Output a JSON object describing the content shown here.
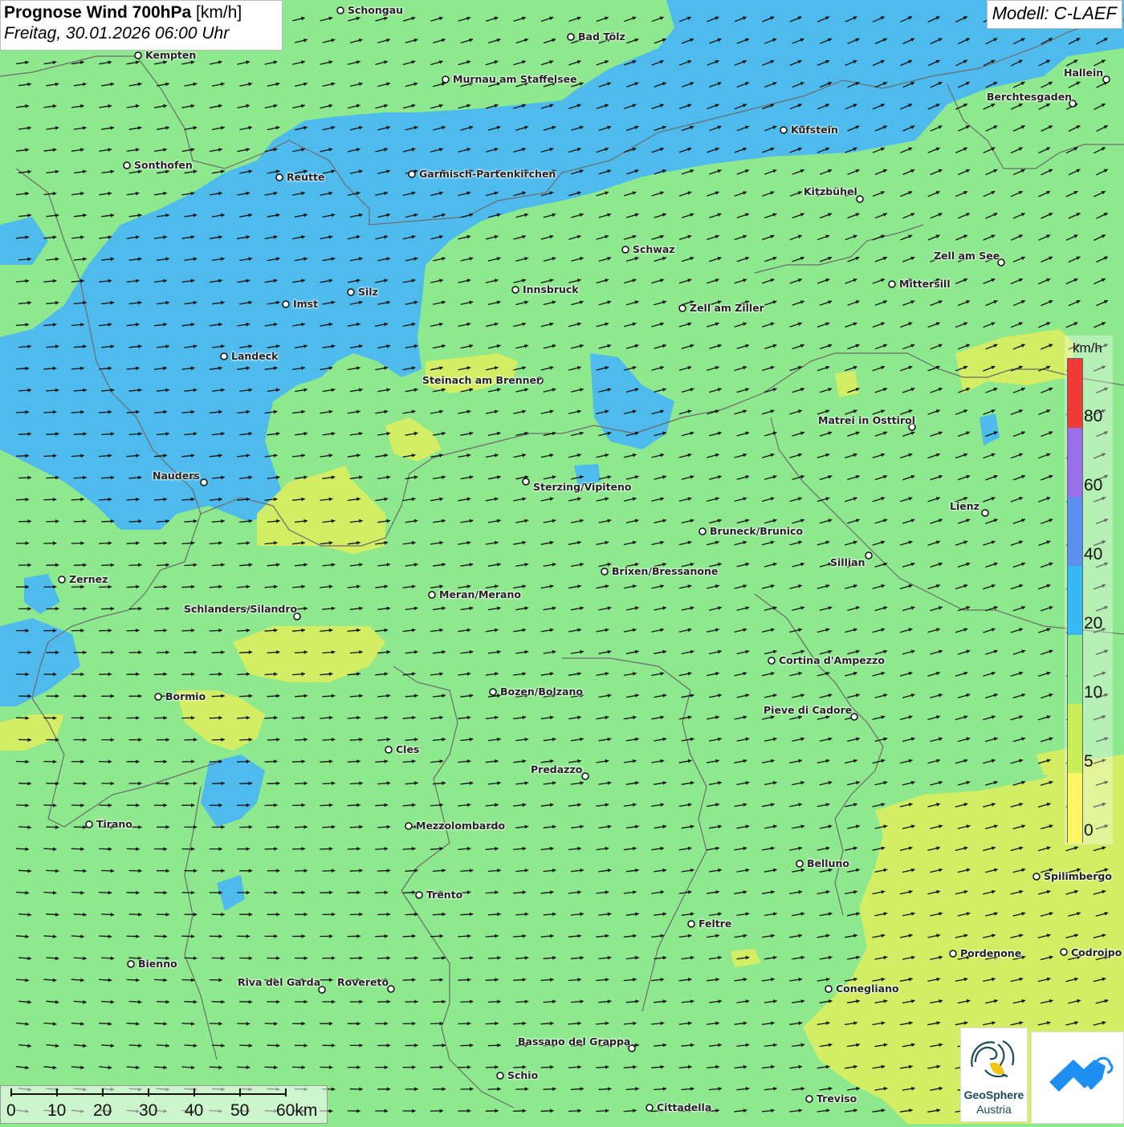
{
  "header": {
    "title_bold": "Prognose Wind 700hPa",
    "title_unit": "[km/h]",
    "datetime": "Freitag, 30.01.2026 06:00 Uhr"
  },
  "model": "Modell: C-LAEF",
  "legend": {
    "unit": "km/h",
    "ticks": [
      "80",
      "60",
      "40",
      "20",
      "10",
      "5",
      "0"
    ],
    "colors": [
      "#f03a35",
      "#9a6ee6",
      "#5b8ff0",
      "#36baf4",
      "#8ee88e",
      "#c8ee5a",
      "#fff666"
    ]
  },
  "scale": {
    "labels": [
      "0",
      "10",
      "20",
      "30",
      "40",
      "50",
      "60km"
    ]
  },
  "logos": {
    "geosphere_line1": "GeoSphere",
    "geosphere_line2": "Austria",
    "geosphere_icon": "geosphere-logo-icon",
    "app_icon": "wetter-app-icon"
  },
  "colors": {
    "calm_yellow": "#f2f07a",
    "moderate_green": "#8ee88e",
    "strong_blue": "#4cb8f2",
    "border_gray": "#6b6b6b"
  },
  "cities": [
    {
      "name": "Schongau"
    },
    {
      "name": "Bad Tölz"
    },
    {
      "name": "Kempten"
    },
    {
      "name": "Murnau am Staffelsee"
    },
    {
      "name": "Hallein"
    },
    {
      "name": "Berchtesgaden"
    },
    {
      "name": "Kufstein"
    },
    {
      "name": "Sonthofen"
    },
    {
      "name": "Reutte"
    },
    {
      "name": "Garmisch-Partenkirchen"
    },
    {
      "name": "Kitzbühel"
    },
    {
      "name": "Schwaz"
    },
    {
      "name": "Zell am See"
    },
    {
      "name": "Mittersill"
    },
    {
      "name": "Innsbruck"
    },
    {
      "name": "Imst"
    },
    {
      "name": "Silz"
    },
    {
      "name": "Zell am Ziller"
    },
    {
      "name": "Landeck"
    },
    {
      "name": "Steinach am Brenner"
    },
    {
      "name": "Matrei in Osttirol"
    },
    {
      "name": "Nauders"
    },
    {
      "name": "Sterzing/Vipiteno"
    },
    {
      "name": "Lienz"
    },
    {
      "name": "Bruneck/Brunico"
    },
    {
      "name": "Sillian"
    },
    {
      "name": "Brixen/Bressanone"
    },
    {
      "name": "Zernez"
    },
    {
      "name": "Meran/Merano"
    },
    {
      "name": "Schlanders/Silandro"
    },
    {
      "name": "Cortina d'Ampezzo"
    },
    {
      "name": "Bozen/Bolzano"
    },
    {
      "name": "Bormio"
    },
    {
      "name": "Pieve di Cadore"
    },
    {
      "name": "Cles"
    },
    {
      "name": "Predazzo"
    },
    {
      "name": "Tirano"
    },
    {
      "name": "Mezzolombardo"
    },
    {
      "name": "Belluno"
    },
    {
      "name": "Spilimbergo"
    },
    {
      "name": "Trento"
    },
    {
      "name": "Feltre"
    },
    {
      "name": "Pordenone"
    },
    {
      "name": "Codroipo"
    },
    {
      "name": "Bienno"
    },
    {
      "name": "Riva del Garda"
    },
    {
      "name": "Rovereto"
    },
    {
      "name": "Conegliano"
    },
    {
      "name": "Bassano del Grappa"
    },
    {
      "name": "Schio"
    },
    {
      "name": "Treviso"
    },
    {
      "name": "Cittadella"
    }
  ]
}
